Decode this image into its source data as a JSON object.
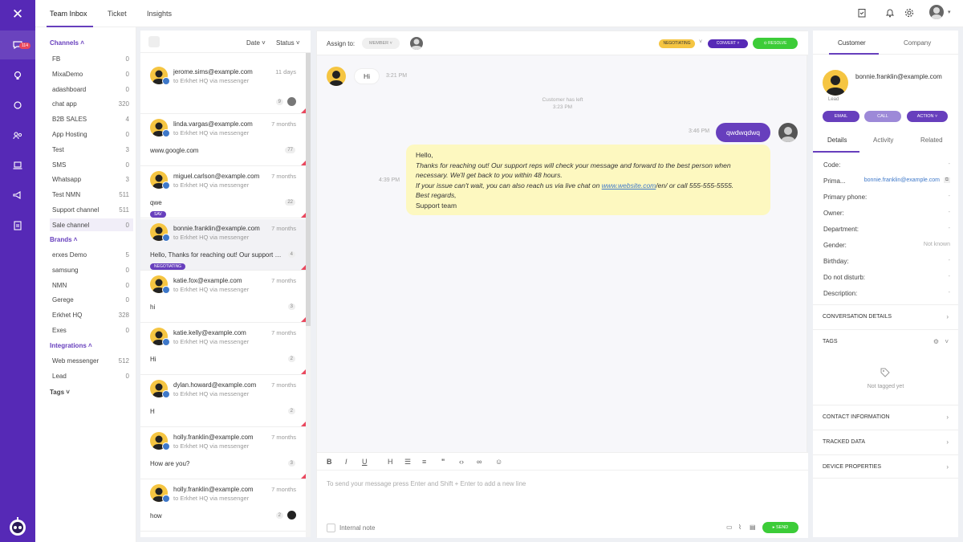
{
  "rail": {
    "badge": "114"
  },
  "topbar": {
    "tabs": [
      "Team Inbox",
      "Ticket",
      "Insights"
    ]
  },
  "sidebar": {
    "channels_heading": "Channels",
    "channels": [
      {
        "name": "FB",
        "count": "0"
      },
      {
        "name": "MixaDemo",
        "count": "0"
      },
      {
        "name": "adashboard",
        "count": "0"
      },
      {
        "name": "chat app",
        "count": "320"
      },
      {
        "name": "B2B SALES",
        "count": "4"
      },
      {
        "name": "App Hosting",
        "count": "0"
      },
      {
        "name": "Test",
        "count": "3"
      },
      {
        "name": "SMS",
        "count": "0"
      },
      {
        "name": "Whatsapp",
        "count": "3"
      },
      {
        "name": "Test NMN",
        "count": "511"
      },
      {
        "name": "Support channel",
        "count": "511"
      },
      {
        "name": "Sale channel",
        "count": "0"
      }
    ],
    "brands_heading": "Brands",
    "brands": [
      {
        "name": "erxes Demo",
        "count": "5"
      },
      {
        "name": "samsung",
        "count": "0"
      },
      {
        "name": "NMN",
        "count": "0"
      },
      {
        "name": "Gerege",
        "count": "0"
      },
      {
        "name": "Erkhet HQ",
        "count": "328"
      },
      {
        "name": "Exes",
        "count": "0"
      }
    ],
    "integrations_heading": "Integrations",
    "integrations": [
      {
        "name": "Web messenger",
        "count": "512"
      },
      {
        "name": "Lead",
        "count": "0"
      }
    ],
    "tags_heading": "Tags"
  },
  "list": {
    "filters": [
      "Date",
      "Status"
    ],
    "conversations": [
      {
        "email": "jerome.sims@example.com",
        "time": "11 days",
        "via": "to Erkhet HQ via messenger",
        "msg": "",
        "count": "9",
        "tag": ""
      },
      {
        "email": "linda.vargas@example.com",
        "time": "7 months",
        "via": "to Erkhet HQ via messenger",
        "msg": "www.google.com",
        "count": "77",
        "tag": ""
      },
      {
        "email": "miguel.carlson@example.com",
        "time": "7 months",
        "via": "to Erkhet HQ via messenger",
        "msg": "qwe",
        "count": "22",
        "tag": "sav"
      },
      {
        "email": "bonnie.franklin@example.com",
        "time": "7 months",
        "via": "to Erkhet HQ via messenger",
        "msg": "Hello, Thanks for reaching out! Our support reps will check",
        "count": "4",
        "tag": "negotiating"
      },
      {
        "email": "katie.fox@example.com",
        "time": "7 months",
        "via": "to Erkhet HQ via messenger",
        "msg": "hi",
        "count": "3",
        "tag": ""
      },
      {
        "email": "katie.kelly@example.com",
        "time": "7 months",
        "via": "to Erkhet HQ via messenger",
        "msg": "Hi",
        "count": "2",
        "tag": ""
      },
      {
        "email": "dylan.howard@example.com",
        "time": "7 months",
        "via": "to Erkhet HQ via messenger",
        "msg": "H",
        "count": "2",
        "tag": ""
      },
      {
        "email": "holly.franklin@example.com",
        "time": "7 months",
        "via": "to Erkhet HQ via messenger",
        "msg": "How are you?",
        "count": "3",
        "tag": ""
      },
      {
        "email": "holly.franklin@example.com",
        "time": "7 months",
        "via": "to Erkhet HQ via messenger",
        "msg": "how",
        "count": "2",
        "tag": ""
      }
    ]
  },
  "chat": {
    "assign_label": "Assign to:",
    "member_label": "MEMBER",
    "status_tag": "NEGOTIATING",
    "convert_label": "CONVERT",
    "resolve_label": "RESOLVE",
    "msg1": {
      "text": "Hi",
      "time": "3:21 PM"
    },
    "system_msg": "Customer has left",
    "system_time": "3:23 PM",
    "msg2": {
      "text": "qwdwqdwq",
      "time": "3:46 PM"
    },
    "msg3": {
      "time": "4:39 PM",
      "l1": "Hello,",
      "l2": "Thanks for reaching out! Our support reps will check your message and forward to the best person when",
      "l3": "necessary. We'll get back to you within 48 hours.",
      "l4a": "If your issue can't wait, you can also reach us via live chat on ",
      "link": "www.website.com",
      "l4b": "/en/ or call 555-555-5555.",
      "l5": "Best regards,",
      "l6": "Support team"
    },
    "placeholder": "To send your message press Enter and Shift + Enter to add a new line",
    "internal_note": "Internal note",
    "send_label": "SEND"
  },
  "panel": {
    "tabs": [
      "Customer",
      "Company"
    ],
    "email": "bonnie.franklin@example.com",
    "lead": "Lead",
    "buttons": [
      "EMAIL",
      "CALL",
      "ACTION"
    ],
    "subtabs": [
      "Details",
      "Activity",
      "Related"
    ],
    "fields": [
      {
        "label": "Code:",
        "value": "-"
      },
      {
        "label": "Prima...",
        "value": "bonnie.franklin@example.com"
      },
      {
        "label": "Primary phone:",
        "value": "-"
      },
      {
        "label": "Owner:",
        "value": "-"
      },
      {
        "label": "Department:",
        "value": "-"
      },
      {
        "label": "Gender:",
        "value": "Not known"
      },
      {
        "label": "Birthday:",
        "value": "-"
      },
      {
        "label": "Do not disturb:",
        "value": "-"
      },
      {
        "label": "Description:",
        "value": "-"
      }
    ],
    "sections": {
      "conversation_details": "CONVERSATION DETAILS",
      "tags": "TAGS",
      "not_tagged": "Not tagged yet",
      "contact_information": "CONTACT INFORMATION",
      "tracked_data": "TRACKED DATA",
      "device_properties": "DEVICE PROPERTIES"
    }
  }
}
